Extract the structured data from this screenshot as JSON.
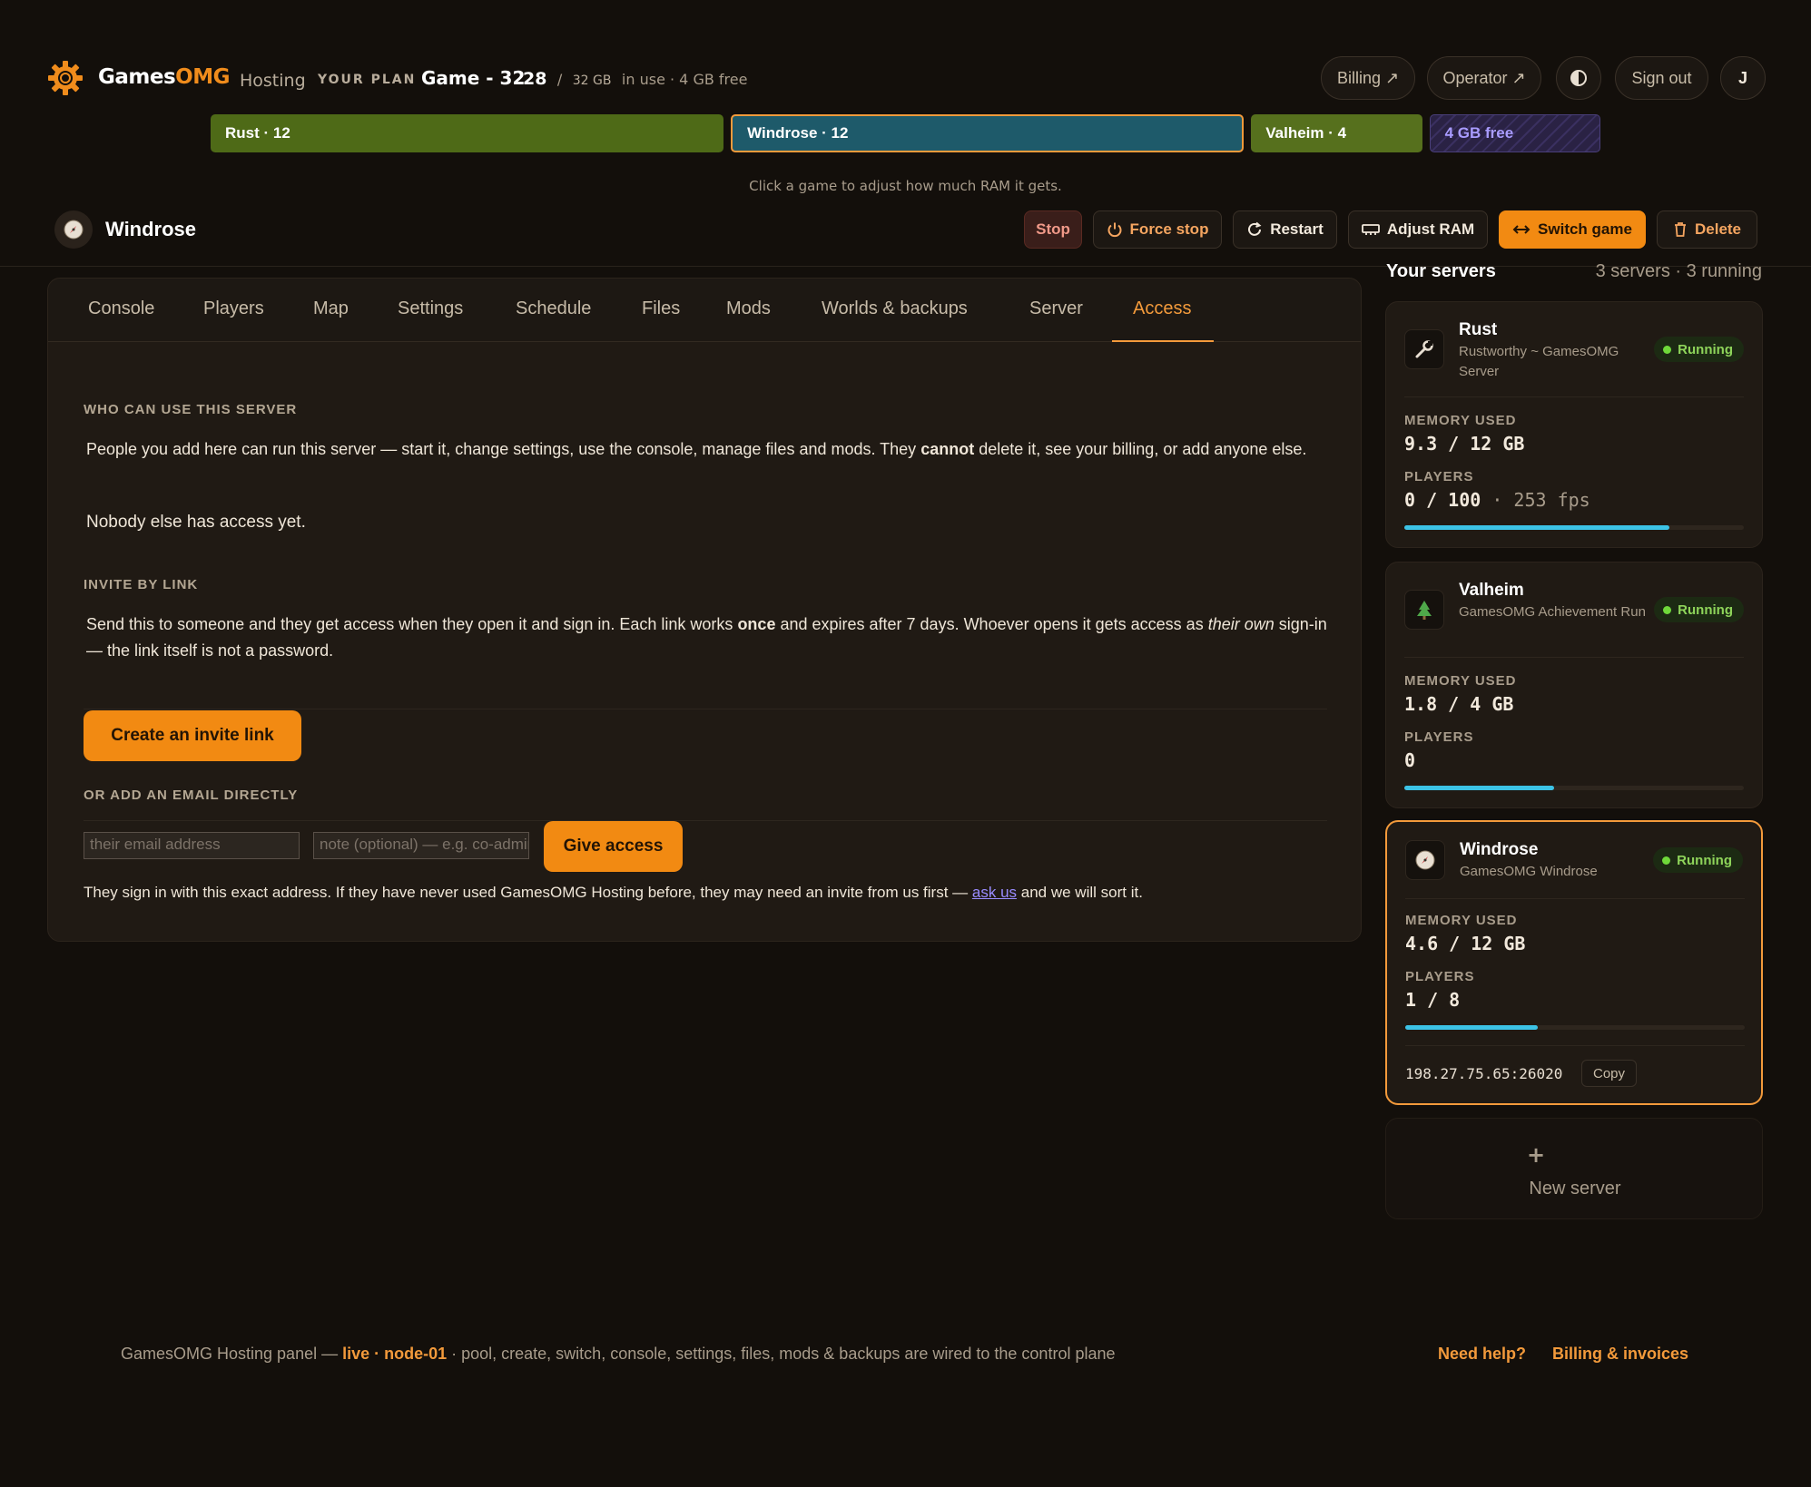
{
  "header": {
    "brand_main": "Games",
    "brand_accent": "OMG",
    "brand_sub": "Hosting",
    "plan_label": "YOUR PLAN",
    "plan_name": "Game - 32",
    "ram_used": "28",
    "ram_sep": "/",
    "ram_total": "32 GB",
    "ram_status": "in use · 4 GB free",
    "buttons": {
      "billing": "Billing ↗",
      "operator": "Operator ↗",
      "sign_out": "Sign out",
      "avatar_initial": "J"
    }
  },
  "ram_allocation": {
    "segments": [
      {
        "label": "Rust · 12",
        "gb": 12,
        "color": "#4e6a17"
      },
      {
        "label": "Windrose · 12",
        "gb": 12,
        "color": "#1e5a6a",
        "selected": true
      },
      {
        "label": "Valheim · 4",
        "gb": 4,
        "color": "#56701d"
      },
      {
        "label": "4 GB free",
        "gb": 4,
        "color": "#2c2548"
      }
    ],
    "hint": "Click a game to adjust how much RAM it gets."
  },
  "server": {
    "name": "Windrose",
    "actions": {
      "stop": "Stop",
      "force_stop": "Force stop",
      "restart": "Restart",
      "adjust_ram": "Adjust RAM",
      "switch_game": "Switch game",
      "delete": "Delete"
    }
  },
  "tabs": [
    "Console",
    "Players",
    "Map",
    "Settings",
    "Schedule",
    "Files",
    "Mods",
    "Worlds & backups",
    "Server",
    "Access"
  ],
  "active_tab": "Access",
  "access": {
    "who_title": "WHO CAN USE THIS SERVER",
    "who_desc_1": "People you add here can run this server — start it, change settings, use the console, manage files and mods. They ",
    "who_desc_bold": "cannot",
    "who_desc_2": " delete it, see your billing, or add anyone else.",
    "nobody": "Nobody else has access yet.",
    "invite_title": "INVITE BY LINK",
    "invite_desc_1": "Send this to someone and they get access when they open it and sign in. Each link works ",
    "invite_desc_bold": "once",
    "invite_desc_2": " and expires after 7 days. Whoever opens it gets access as ",
    "invite_desc_italic": "their own",
    "invite_desc_3": " sign-in — the link itself is not a password.",
    "create_button": "Create an invite link",
    "email_title": "OR ADD AN EMAIL DIRECTLY",
    "email_placeholder": "their email address",
    "note_placeholder": "note (optional) — e.g. co-admin",
    "give_button": "Give access",
    "footnote_1": "They sign in with this exact address. If they have never used GamesOMG Hosting before, they may need an invite from us first — ",
    "footnote_link": "ask us",
    "footnote_2": " and we will sort it."
  },
  "sidebar": {
    "title": "Your servers",
    "count": "3 servers · 3 running",
    "servers": [
      {
        "name": "Rust",
        "sub": "Rustworthy ~ GamesOMG Server",
        "status": "Running",
        "memory_label": "MEMORY USED",
        "memory": "9.3 / 12 GB",
        "players_label": "PLAYERS",
        "players": "0 / 100",
        "extra": " · 253 fps",
        "usage": 0.78,
        "icon": "wrench-icon"
      },
      {
        "name": "Valheim",
        "sub": "GamesOMG Achievement Run",
        "status": "Running",
        "memory_label": "MEMORY USED",
        "memory": "1.8 / 4 GB",
        "players_label": "PLAYERS",
        "players": "0",
        "usage": 0.44,
        "icon": "tree-icon"
      },
      {
        "name": "Windrose",
        "sub": "GamesOMG Windrose",
        "status": "Running",
        "memory_label": "MEMORY USED",
        "memory": "4.6 / 12 GB",
        "players_label": "PLAYERS",
        "players": "1 / 8",
        "usage": 0.39,
        "address": "198.27.75.65:26020",
        "copy": "Copy",
        "icon": "compass-icon"
      }
    ],
    "new_server_plus": "+",
    "new_server": "New server"
  },
  "footer": {
    "text_1": "GamesOMG Hosting panel — ",
    "live": "live · node-01",
    "text_2": " · pool, create, switch, console, settings, files, mods & backups are wired to the control plane",
    "help": "Need help?",
    "billing": "Billing & invoices"
  },
  "colors": {
    "accent": "#f28a12",
    "background": "#130f0b",
    "running": "#6fd83a",
    "bar": "#3cc3e6"
  }
}
